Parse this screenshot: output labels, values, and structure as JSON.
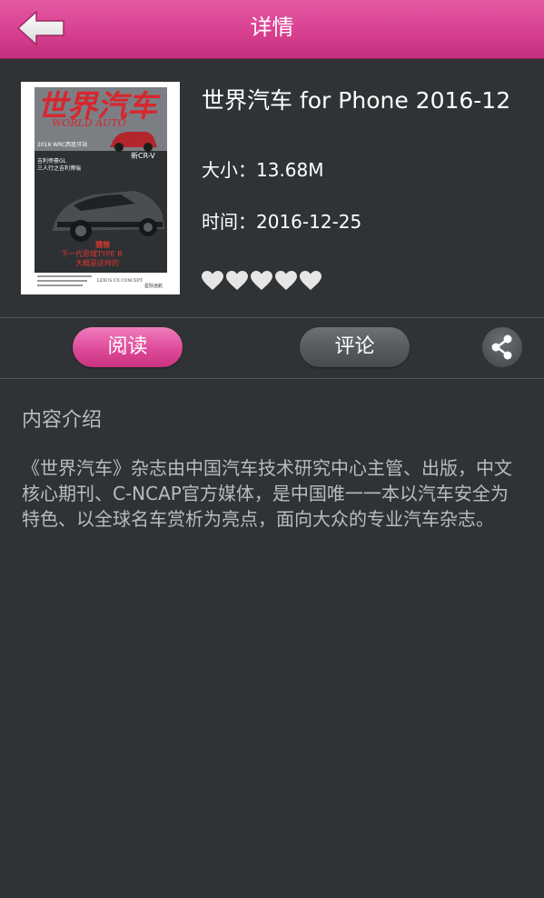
{
  "header": {
    "back_icon": "back-arrow-icon",
    "title": "详情"
  },
  "magazine": {
    "cover": {
      "masthead": "世界汽车",
      "masthead_en": "WORLD AUTO",
      "badge": "新CR-V",
      "cover_lines": [
        "2016 WRC西班牙站",
        "吉利帝豪GL",
        "三人行之吉利博瑞"
      ],
      "headline": [
        "猜想",
        "下一代思域TYPE R",
        "大概是这样的"
      ],
      "footer_left": "LEXUS UX CONCEPT",
      "footer_right": "星际迷航"
    },
    "title": "世界汽车 for Phone 2016-12",
    "size": "大小：13.68M",
    "time": "时间：2016-12-25",
    "rating": {
      "value": 0,
      "max": 5,
      "icon": "heart-icon",
      "empty_color": "#e6e6e6"
    }
  },
  "actions": {
    "read_label": "阅读",
    "comment_label": "评论",
    "share_icon": "share-icon"
  },
  "intro": {
    "heading": "内容介绍",
    "body": "《世界汽车》杂志由中国汽车技术研究中心主管、出版，中文核心期刊、C-NCAP官方媒体，是中国唯一一本以汽车安全为特色、以全球名车赏析为亮点，面向大众的专业汽车杂志。"
  },
  "colors": {
    "accent": "#d8408f",
    "background": "#2f3335",
    "text_muted": "#b8bcbf"
  }
}
